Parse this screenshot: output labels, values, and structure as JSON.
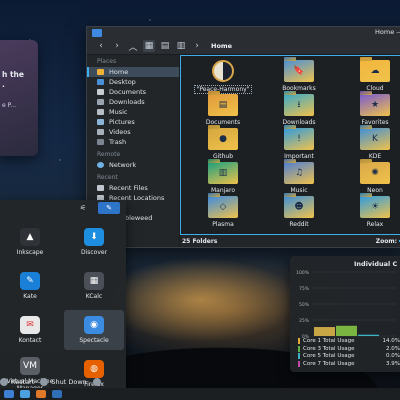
{
  "notification": {
    "line1": "h the",
    "line2": ".",
    "line3": "e P..."
  },
  "dolphin": {
    "window_title": "Home —",
    "breadcrumb": "Home",
    "sidebar": {
      "places_header": "Places",
      "places": [
        "Home",
        "Desktop",
        "Documents",
        "Downloads",
        "Music",
        "Pictures",
        "Videos",
        "Trash"
      ],
      "remote_header": "Remote",
      "remote": [
        "Network"
      ],
      "recent_header": "Recent",
      "recent": [
        "Recent Files",
        "Recent Locations"
      ],
      "partial_item": "bleweed"
    },
    "items": [
      {
        "label": "\"Peace-Harmony\"",
        "icon": "yin-yang-icon"
      },
      {
        "label": "Bookmarks",
        "icon": "bookmark-icon"
      },
      {
        "label": "Cloud",
        "icon": "cloud-icon"
      },
      {
        "label": "Documents",
        "icon": "document-icon"
      },
      {
        "label": "Downloads",
        "icon": "download-icon"
      },
      {
        "label": "Favorites",
        "icon": "star-icon"
      },
      {
        "label": "Github",
        "icon": "github-icon"
      },
      {
        "label": "Important",
        "icon": "important-icon"
      },
      {
        "label": "KDE",
        "icon": "kde-icon"
      },
      {
        "label": "Manjaro",
        "icon": "manjaro-icon"
      },
      {
        "label": "Music",
        "icon": "music-icon"
      },
      {
        "label": "Neon",
        "icon": "neon-icon"
      },
      {
        "label": "Plasma",
        "icon": "plasma-icon"
      },
      {
        "label": "Reddit",
        "icon": "reddit-icon"
      },
      {
        "label": "Relax",
        "icon": "relax-icon"
      }
    ],
    "status": {
      "count": "25 Folders",
      "zoom_label": "Zoom:"
    }
  },
  "launcher": {
    "apps": [
      {
        "label": "Inkscape",
        "icon": "inkscape-icon",
        "color": "#2f3338"
      },
      {
        "label": "Discover",
        "icon": "discover-icon",
        "color": "#1e8fe0"
      },
      {
        "label": "Kate",
        "icon": "kate-icon",
        "color": "#1a7fd6"
      },
      {
        "label": "KCalc",
        "icon": "kcalc-icon",
        "color": "#4b5058"
      },
      {
        "label": "Kontact",
        "icon": "kontact-icon",
        "color": "#e8e8e8"
      },
      {
        "label": "Spectacle",
        "icon": "spectacle-icon",
        "color": "#3b8be0"
      },
      {
        "label": "Virtual Machine Manager",
        "icon": "vm-icon",
        "color": "#5a5f66"
      },
      {
        "label": "Firefox",
        "icon": "firefox-icon",
        "color": "#e66000"
      }
    ],
    "footer": {
      "restart": "Restart",
      "shutdown": "Shut Down"
    }
  },
  "sysmon": {
    "title": "Individual C",
    "accent": "#3daee9"
  },
  "chart_data": {
    "type": "bar",
    "title": "Individual C",
    "ylim": [
      0,
      100
    ],
    "yticks": [
      "100%",
      "75%",
      "50%",
      "25%",
      "0%"
    ],
    "series": [
      {
        "name": "Core 1 Total Usage",
        "value": "14.0%",
        "num": 14.0,
        "color": "#e0a93a"
      },
      {
        "name": "Core 3 Total Usage",
        "value": "2.0%",
        "num": 2.0,
        "color": "#5fb24a"
      },
      {
        "name": "Core 5 Total Usage",
        "value": "0.0%",
        "num": 0.0,
        "color": "#3ab3c9"
      },
      {
        "name": "Core 7 Total Usage",
        "value": "3.9%",
        "num": 3.9,
        "color": "#c04aa8"
      }
    ],
    "bars": [
      {
        "num": 14.0,
        "color": "#c8a646"
      },
      {
        "num": 16.0,
        "color": "#7ab542"
      },
      {
        "num": 2.0,
        "color": "#3ab3c9"
      }
    ]
  }
}
